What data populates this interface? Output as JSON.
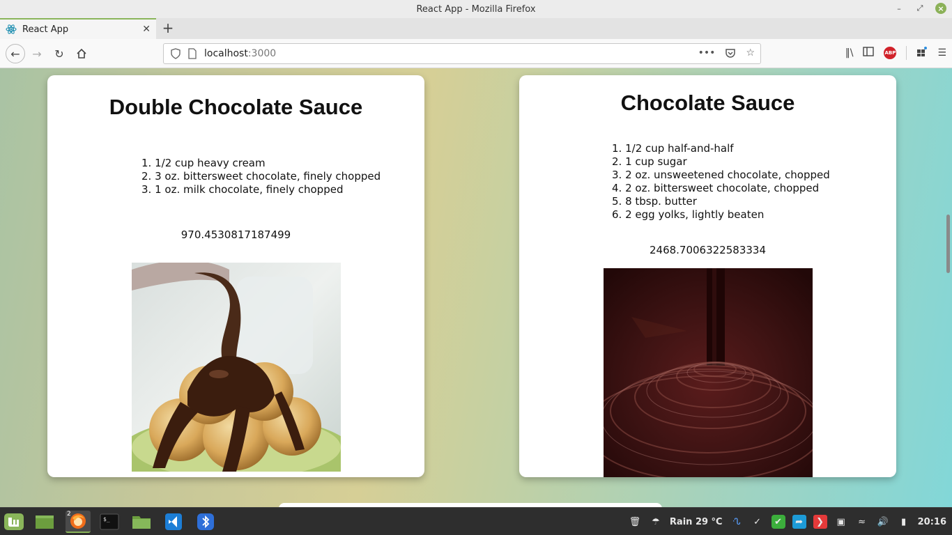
{
  "window": {
    "title": "React App - Mozilla Firefox"
  },
  "tab": {
    "title": "React App"
  },
  "urlbar": {
    "host": "localhost",
    "port": ":3000",
    "more": "•••"
  },
  "cards": [
    {
      "title": "Double Chocolate Sauce",
      "ingredients": [
        "1/2 cup heavy cream",
        "3 oz. bittersweet chocolate, finely chopped",
        "1 oz. milk chocolate, finely chopped"
      ],
      "number": "970.4530817187499",
      "image": "chocolate-sauce-poured-on-profiteroles"
    },
    {
      "title": "Chocolate Sauce",
      "ingredients": [
        "1/2 cup half-and-half",
        "1 cup sugar",
        "2 oz. unsweetened chocolate, chopped",
        "2 oz. bittersweet chocolate, chopped",
        "8 tbsp. butter",
        "2 egg yolks, lightly beaten"
      ],
      "number": "2468.7006322583334",
      "image": "melted-chocolate-swirl"
    }
  ],
  "taskbar": {
    "firefox_badge": "2",
    "weather": "Rain 29 °C",
    "clock": "20:16"
  },
  "colors": {
    "accent": "#8ab55a",
    "abp": "#d1222a"
  }
}
